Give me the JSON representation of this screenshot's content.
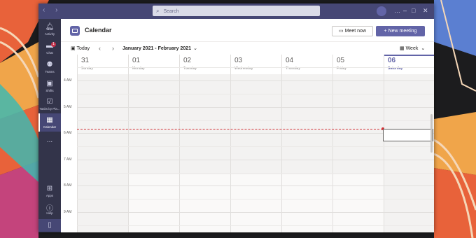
{
  "titlebar": {
    "search_placeholder": "Search"
  },
  "rail": {
    "items": [
      {
        "label": "Activity",
        "icon": "bell-icon"
      },
      {
        "label": "Chat",
        "icon": "chat-icon",
        "badge": "1"
      },
      {
        "label": "Teams",
        "icon": "teams-icon"
      },
      {
        "label": "Shifts",
        "icon": "shifts-icon"
      },
      {
        "label": "Tasks by Pla...",
        "icon": "tasks-icon"
      },
      {
        "label": "Calendar",
        "icon": "calendar-icon",
        "active": true
      },
      {
        "label": "...",
        "icon": "more-icon"
      }
    ],
    "bottom": [
      {
        "label": "Apps",
        "icon": "apps-icon"
      },
      {
        "label": "Help",
        "icon": "help-icon"
      },
      {
        "label": "",
        "icon": "device-icon"
      }
    ]
  },
  "header": {
    "title": "Calendar",
    "meet_now": "Meet now",
    "new_meeting": "New meeting"
  },
  "toolbar": {
    "today": "Today",
    "range": "January 2021 - February 2021",
    "view": "Week"
  },
  "days": [
    {
      "num": "31",
      "name": "Sunday"
    },
    {
      "num": "01",
      "name": "Monday"
    },
    {
      "num": "02",
      "name": "Tuesday"
    },
    {
      "num": "03",
      "name": "Wednesday"
    },
    {
      "num": "04",
      "name": "Thursday"
    },
    {
      "num": "05",
      "name": "Friday"
    },
    {
      "num": "06",
      "name": "Saturday",
      "today": true
    }
  ],
  "times": [
    "4 AM",
    "5 AM",
    "6 AM",
    "7 AM",
    "8 AM",
    "9 AM"
  ],
  "colors": {
    "accent": "#6264a7",
    "titlebar": "#464775",
    "rail": "#33344a",
    "now_line": "#d13438"
  }
}
